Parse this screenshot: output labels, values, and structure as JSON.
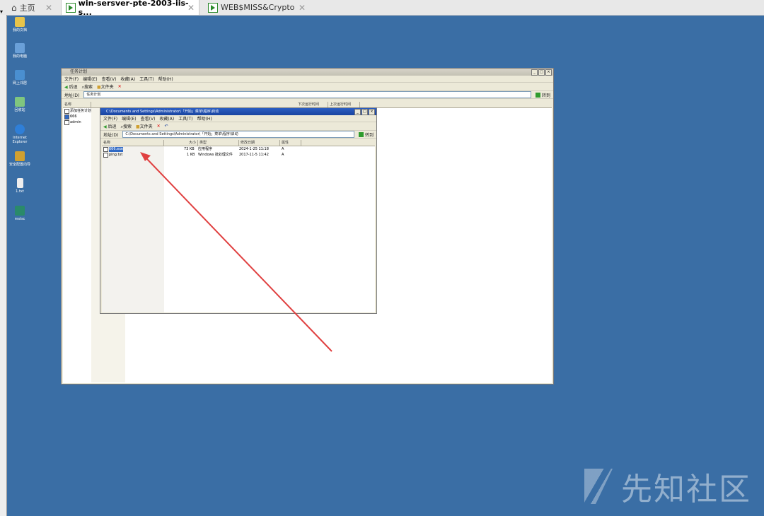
{
  "tabs": [
    {
      "label": "主页",
      "icon": "home-icon"
    },
    {
      "label": "win-sersver-pte-2003-iis-s...",
      "icon": "vm-icon"
    },
    {
      "label": "WEB$MISS&Crypto",
      "icon": "vm-icon"
    }
  ],
  "desktop": {
    "icons": [
      {
        "label": "我的文档",
        "color": "#e8c44a"
      },
      {
        "label": "我的电脑",
        "color": "#6aa0d8"
      },
      {
        "label": "网上邻居",
        "color": "#4a8fd0"
      },
      {
        "label": "回收站",
        "color": "#7fc67f"
      },
      {
        "label": "Internet Explorer",
        "color": "#2f7fd8"
      },
      {
        "label": "安全配置向导",
        "color": "#d0a030"
      },
      {
        "label": "1.txt",
        "color": "#eeeeee"
      },
      {
        "label": "mstsc",
        "color": "#2a8a6a"
      }
    ]
  },
  "back_window": {
    "title": "任务计划",
    "menu": [
      "文件(F)",
      "编辑(E)",
      "查看(V)",
      "收藏(A)",
      "工具(T)",
      "帮助(H)"
    ],
    "toolbar": [
      "后退",
      "搜索",
      "文件夹"
    ],
    "address_label": "地址(D)",
    "address_value": "任务计划",
    "go_label": "转到",
    "tree_header": "名称",
    "tree_items": [
      "添加任务计划",
      "666",
      "admin"
    ],
    "col_extra": [
      "下次运行时间",
      "上次运行时间"
    ]
  },
  "front_window": {
    "title": "C:\\Documents and Settings\\Administrator\\「开始」菜单\\程序\\启动",
    "menu": [
      "文件(F)",
      "编辑(E)",
      "查看(V)",
      "收藏(A)",
      "工具(T)",
      "帮助(H)"
    ],
    "toolbar": [
      "后退",
      "搜索",
      "文件夹"
    ],
    "address_label": "地址(D)",
    "address_value": "C:\\Documents and Settings\\Administrator\\「开始」菜单\\程序\\启动",
    "go_label": "转到",
    "columns": [
      "名称",
      "大小",
      "类型",
      "修改日期",
      "属性"
    ],
    "files": [
      {
        "name": "666.exe",
        "size": "73 KB",
        "type": "应用程序",
        "date": "2024-1-25 11:18",
        "attr": "A"
      },
      {
        "name": "ping.txt",
        "size": "1 KB",
        "type": "Windows 批处理文件",
        "date": "2017-11-5 11:42",
        "attr": "A"
      }
    ]
  },
  "watermark": "先知社区"
}
